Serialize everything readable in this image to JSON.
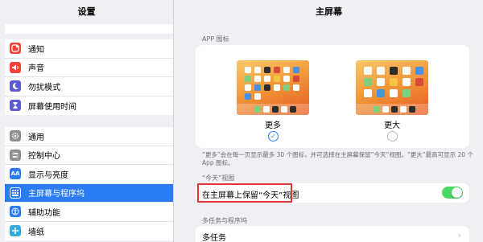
{
  "sidebar": {
    "title": "设置",
    "group1": [
      {
        "label": "通知",
        "icon": "notification-icon",
        "color": "#f0443b"
      },
      {
        "label": "声音",
        "icon": "sound-icon",
        "color": "#f0443b"
      },
      {
        "label": "勿扰模式",
        "icon": "moon-icon",
        "color": "#5d5ad6"
      },
      {
        "label": "屏幕使用时间",
        "icon": "hourglass-icon",
        "color": "#5d5ad6"
      }
    ],
    "group2": [
      {
        "label": "通用",
        "icon": "gear-icon",
        "color": "#8e8e93"
      },
      {
        "label": "控制中心",
        "icon": "control-center-icon",
        "color": "#8e8e93"
      },
      {
        "label": "显示与亮度",
        "icon": "display-icon",
        "color": "#2c7cf6",
        "glyph": "AA"
      },
      {
        "label": "主屏幕与程序坞",
        "icon": "home-screen-icon",
        "color": "#2c7cf6",
        "active": true
      },
      {
        "label": "辅助功能",
        "icon": "accessibility-icon",
        "color": "#2c7cf6"
      },
      {
        "label": "墙纸",
        "icon": "wallpaper-icon",
        "color": "#36aadc"
      }
    ]
  },
  "main": {
    "title": "主屏幕",
    "app_icons_header": "APP 图标",
    "option_more": "更多",
    "option_bigger": "更大",
    "description": "“更多”会在每一页显示最多 30 个图标，并可选择在主屏幕保留“今天”视图。“更大”最高可显示 20 个 App 图标。",
    "today_header": "“今天”视图",
    "keep_today_label": "在主屏幕上保留“今天”视图",
    "keep_today_on": true,
    "multitask_header": "多任务与程序坞",
    "multitask_label": "多任务"
  },
  "colors": {
    "accent": "#2c7cf6",
    "toggle_on": "#4cd964",
    "highlight": "#e53935"
  }
}
